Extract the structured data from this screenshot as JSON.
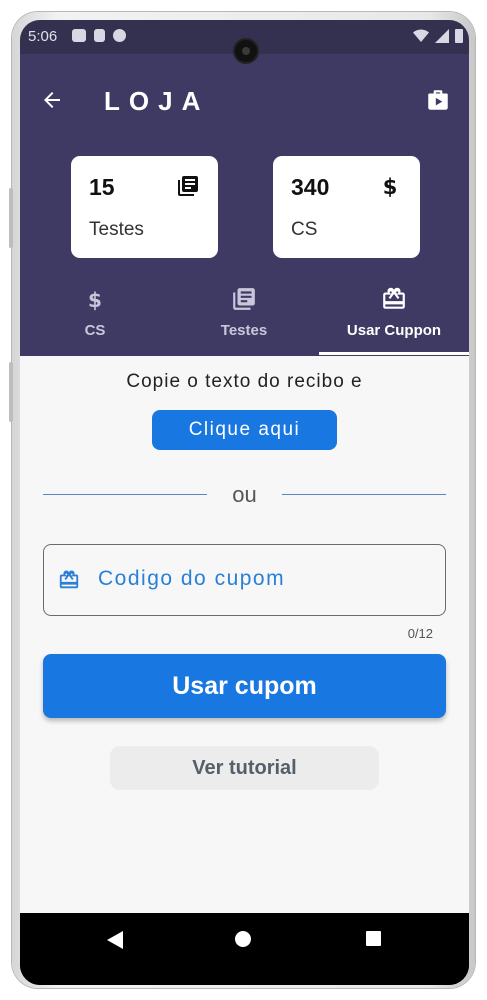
{
  "status_bar": {
    "time": "5:06",
    "left_icons": [
      "youtube-icon",
      "sd-card-icon",
      "sync-icon"
    ],
    "right_icons": [
      "wifi-icon",
      "signal-icon",
      "battery-icon"
    ]
  },
  "header": {
    "back_icon": "arrow-left-icon",
    "title": "LOJA",
    "store_icon": "shopping-bag-icon",
    "background": "#3f3a63"
  },
  "cards": [
    {
      "value": "15",
      "label": "Testes",
      "icon": "library-books-icon"
    },
    {
      "value": "340",
      "label": "CS",
      "icon": "dollar-icon"
    }
  ],
  "tabs": [
    {
      "label": "CS",
      "icon": "dollar-icon",
      "active": false
    },
    {
      "label": "Testes",
      "icon": "library-books-icon",
      "active": false
    },
    {
      "label": "Usar Cuppon",
      "icon": "gift-card-icon",
      "active": true
    }
  ],
  "content": {
    "instruction": "Copie o texto do recibo e",
    "copy_button": "Clique aqui",
    "divider_text": "ou",
    "coupon_field": {
      "placeholder": "Codigo do cupom",
      "value": "",
      "icon": "gift-card-icon"
    },
    "counter": "0/12",
    "submit_button": "Usar cupom",
    "tutorial_button": "Ver tutorial"
  },
  "colors": {
    "accent": "#1877e0",
    "header": "#3f3a63",
    "status": "#34304f"
  }
}
